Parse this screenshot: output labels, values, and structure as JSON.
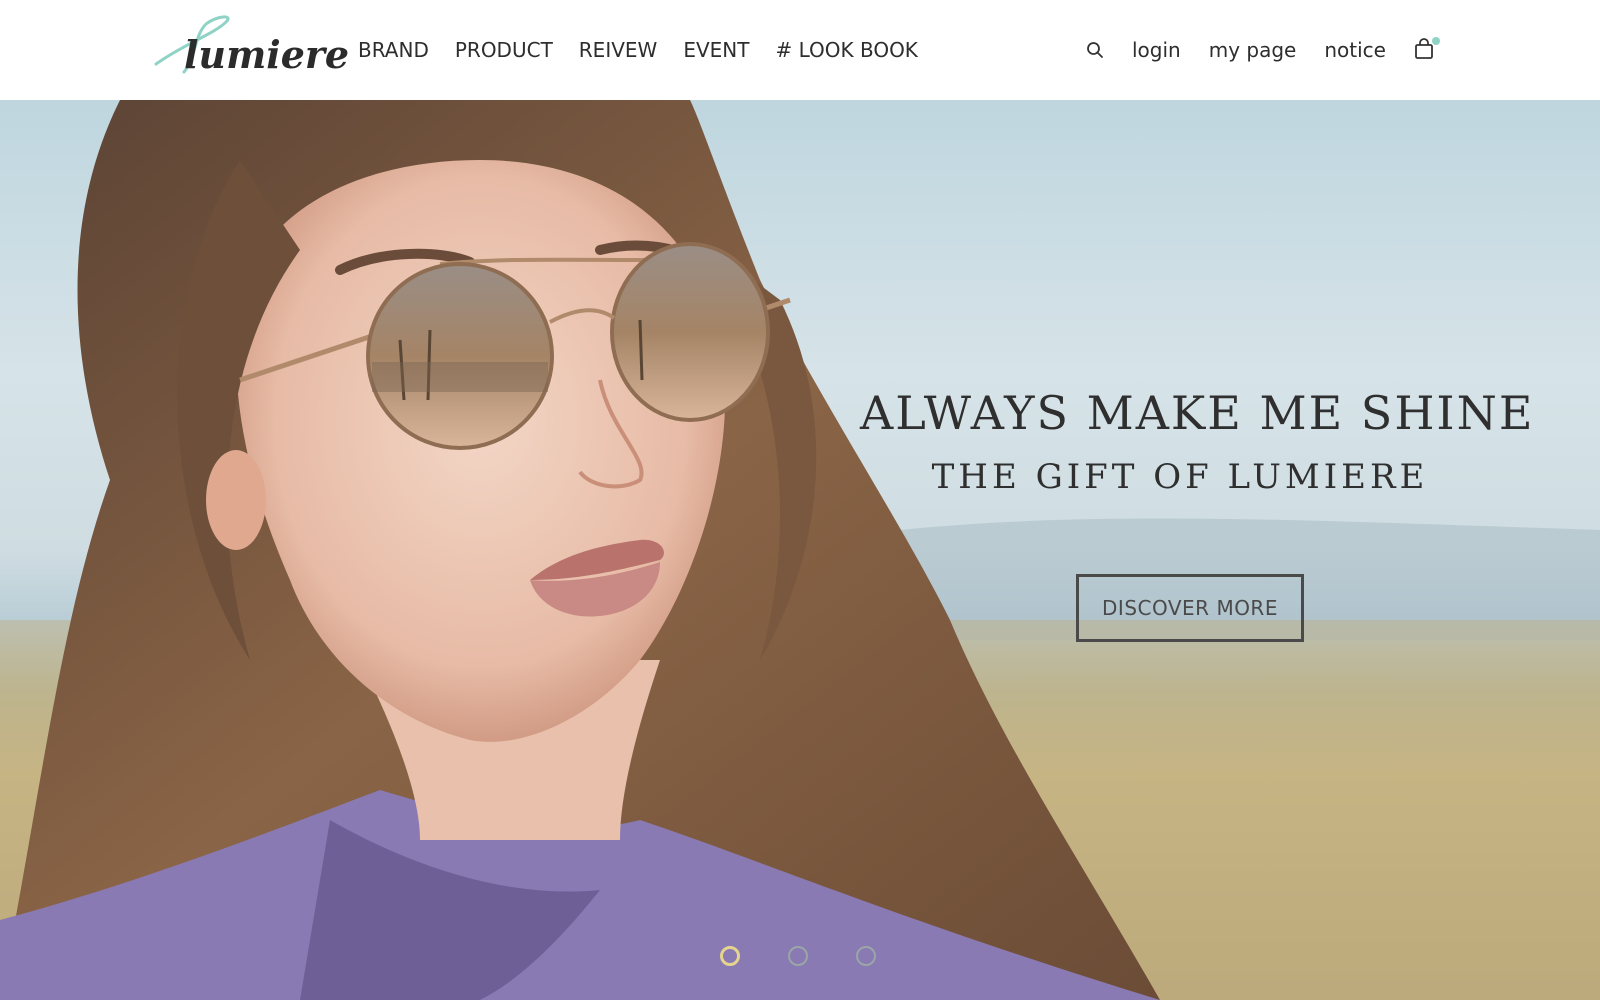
{
  "brand": {
    "logo_text": "lumiere",
    "accent_color": "#8fd3c6"
  },
  "main_nav": [
    {
      "label": "BRAND"
    },
    {
      "label": "PRODUCT"
    },
    {
      "label": "REIVEW"
    },
    {
      "label": "EVENT"
    },
    {
      "label": "# LOOK BOOK"
    }
  ],
  "util_nav": {
    "search_icon": "search-icon",
    "links": [
      {
        "label": "login"
      },
      {
        "label": "my page"
      },
      {
        "label": "notice"
      }
    ],
    "cart_icon": "shopping-bag-icon"
  },
  "hero": {
    "headline": "ALWAYS MAKE ME SHINE",
    "subline": "THE GIFT OF LUMIERE",
    "cta_label": "DISCOVER MORE",
    "slides_total": 3,
    "active_slide": 1,
    "active_dot_color": "#e4d48d"
  }
}
